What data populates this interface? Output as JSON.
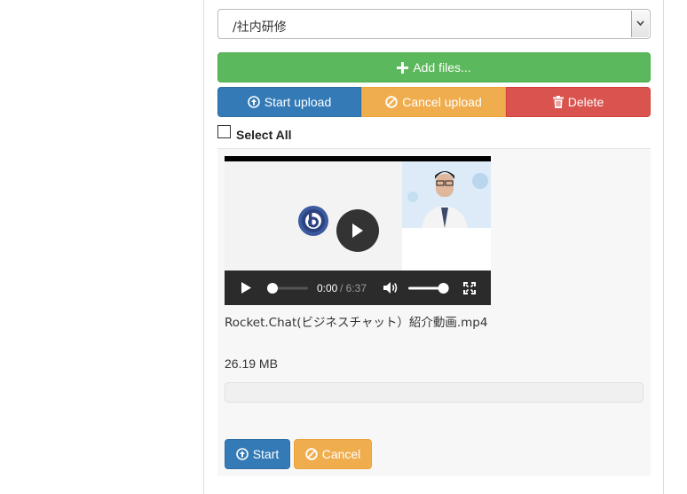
{
  "folder": {
    "selected": "/社内研修"
  },
  "toolbar": {
    "add_files": "Add files...",
    "start_upload": "Start upload",
    "cancel_upload": "Cancel upload",
    "delete": "Delete"
  },
  "select_all": {
    "label": "Select All",
    "checked": false
  },
  "file": {
    "name": "Rocket.Chat(ビジネスチャット）紹介動画.mp4",
    "size": "26.19 MB",
    "progress": 0,
    "video": {
      "current_time": "0:00",
      "duration": "/ 6:37",
      "played_fraction": 0,
      "volume": 0.9
    },
    "start_label": "Start",
    "cancel_label": "Cancel"
  },
  "colors": {
    "success": "#5cb85c",
    "primary": "#337ab7",
    "warning": "#f0ad4e",
    "danger": "#d9534f"
  }
}
